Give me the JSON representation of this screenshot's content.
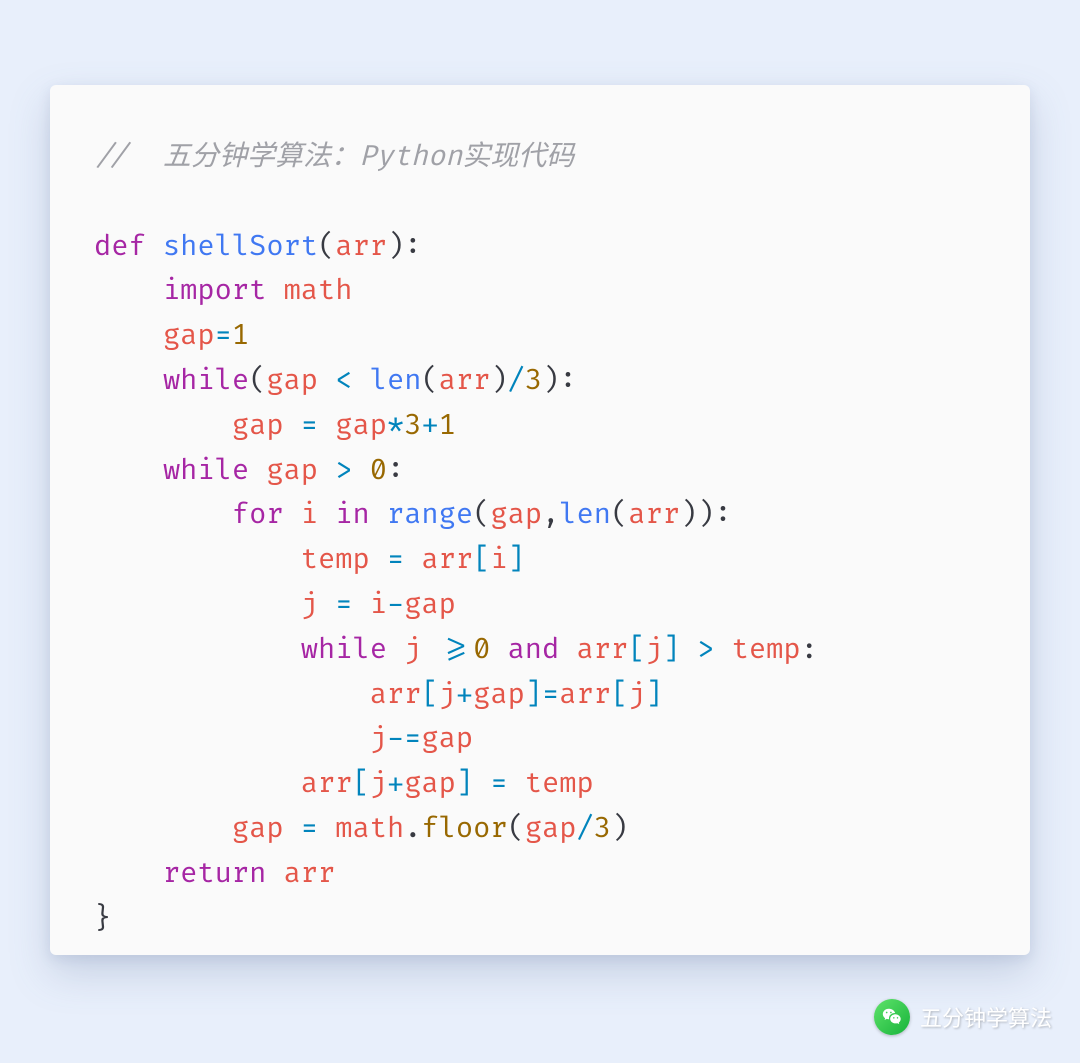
{
  "code": {
    "comment": "//  五分钟学算法：Python实现代码",
    "tokens": {
      "def": "def",
      "while": "while",
      "for": "for",
      "in": "in",
      "return": "return",
      "import": "import",
      "and": "and",
      "shellSort": "shellSort",
      "len": "len",
      "range": "range",
      "arr": "arr",
      "gap": "gap",
      "i": "i",
      "j": "j",
      "temp": "temp",
      "math": "math",
      "floor": "floor",
      "n0": "0",
      "n1": "1",
      "n3": "3",
      "lp": "(",
      "rp": ")",
      "colon": ":",
      "comma": ",",
      "dot": ".",
      "eq": "=",
      "lt": "<",
      "gt": ">",
      "ge": ">=",
      "star": "*",
      "plus": "+",
      "minus": "-",
      "slash": "/",
      "lbr": "[",
      "rbr": "]",
      "mineq": "-=",
      "rbrace": "}"
    }
  },
  "watermark": {
    "text": "五分钟学算法"
  }
}
